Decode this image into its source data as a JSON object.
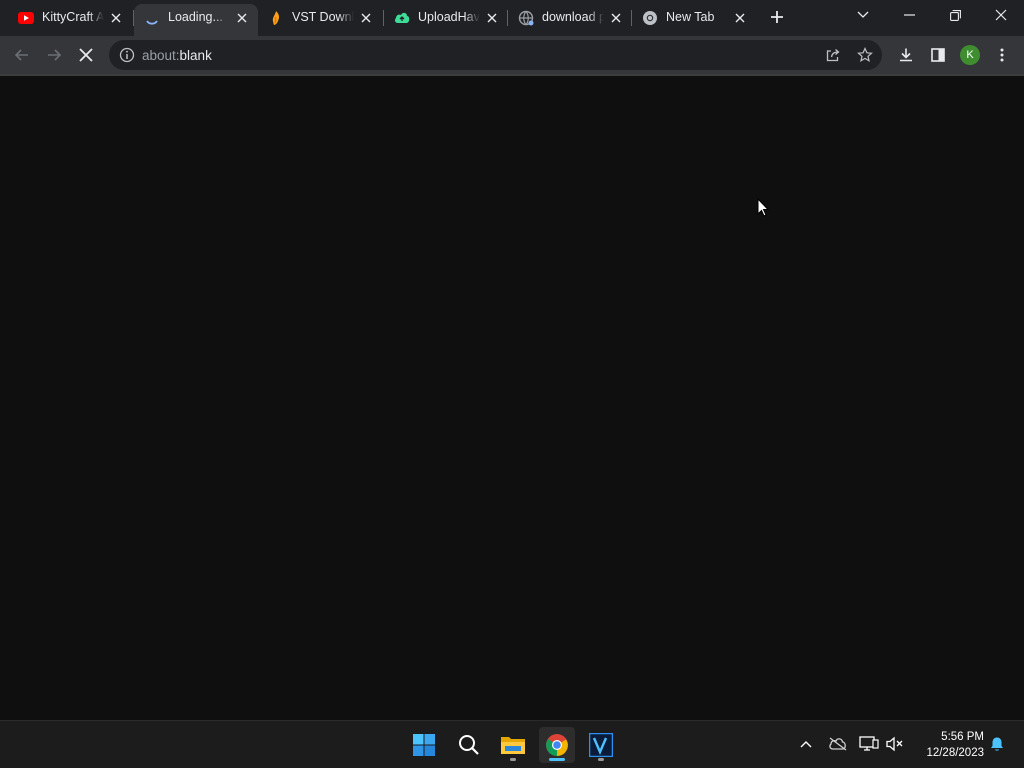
{
  "browser": {
    "tabs": [
      {
        "title": "KittyCraft A",
        "favicon": "youtube-icon",
        "active": false
      },
      {
        "title": "Loading...",
        "favicon": "loading-spinner-icon",
        "active": true
      },
      {
        "title": "VST Downlo",
        "favicon": "fl-studio-icon",
        "active": false
      },
      {
        "title": "UploadHave",
        "favicon": "cloud-upload-icon",
        "active": false
      },
      {
        "title": "download p",
        "favicon": "globe-icon",
        "active": false
      },
      {
        "title": "New Tab",
        "favicon": "chrome-icon",
        "active": false
      }
    ],
    "omnibox": {
      "scheme": "about:",
      "host": "blank"
    },
    "profile_initial": "K",
    "accent_color": "#3e8e2f"
  },
  "taskbar": {
    "apps": [
      {
        "name": "start-icon",
        "active": false
      },
      {
        "name": "search-icon",
        "active": false
      },
      {
        "name": "file-explorer-icon",
        "active": false
      },
      {
        "name": "chrome-icon",
        "active": true
      },
      {
        "name": "vegas-icon",
        "active": false
      }
    ],
    "clock": {
      "time": "5:56 PM",
      "date": "12/28/2023"
    }
  }
}
